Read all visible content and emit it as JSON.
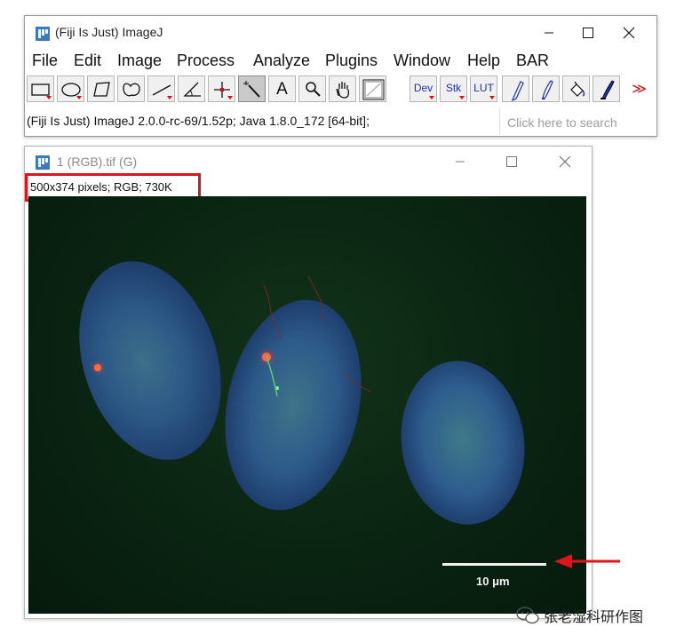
{
  "main_window": {
    "title": "(Fiji Is Just) ImageJ",
    "controls": {
      "minimize": "minimize",
      "maximize": "maximize",
      "close": "close"
    },
    "menu": [
      "File",
      "Edit",
      "Image",
      "Process",
      "Analyze",
      "Plugins",
      "Window",
      "Help",
      "BAR"
    ],
    "tools": [
      {
        "name": "rectangle-tool",
        "icon": "rectangle-icon"
      },
      {
        "name": "oval-tool",
        "icon": "oval-icon"
      },
      {
        "name": "polygon-tool",
        "icon": "polygon-icon"
      },
      {
        "name": "freehand-tool",
        "icon": "freehand-icon"
      },
      {
        "name": "line-tool",
        "icon": "line-icon"
      },
      {
        "name": "angle-tool",
        "icon": "angle-icon"
      },
      {
        "name": "point-tool",
        "icon": "crosshair-icon"
      },
      {
        "name": "wand-tool",
        "icon": "wand-icon"
      },
      {
        "name": "text-tool",
        "icon": "text-icon",
        "label": "A"
      },
      {
        "name": "zoom-tool",
        "icon": "magnifier-icon"
      },
      {
        "name": "hand-tool",
        "icon": "hand-icon"
      },
      {
        "name": "color-picker-tool",
        "icon": "color-picker-icon"
      },
      {
        "name": "dev-tool",
        "label": "Dev"
      },
      {
        "name": "stk-tool",
        "label": "Stk"
      },
      {
        "name": "lut-tool",
        "label": "LUT"
      },
      {
        "name": "pencil-tool",
        "icon": "pencil-icon"
      },
      {
        "name": "brush-tool",
        "icon": "brush-icon"
      },
      {
        "name": "flood-fill-tool",
        "icon": "paint-bucket-icon"
      },
      {
        "name": "paintbrush-tool",
        "icon": "paintbrush-icon"
      },
      {
        "name": "more-tools",
        "icon": "double-chevron-icon",
        "label": "≫"
      }
    ],
    "status": "(Fiji Is Just) ImageJ 2.0.0-rc-69/1.52p; Java 1.8.0_172 [64-bit];",
    "search_placeholder": "Click here to search"
  },
  "image_window": {
    "title": "1 (RGB).tif (G)",
    "info": "500x374 pixels; RGB; 730K",
    "scale_bar_label": "10 μm"
  },
  "colors": {
    "highlight": "#e0131a",
    "tool_accent": "#1b2fbf",
    "tool_dropdown": "#d01010"
  },
  "watermark": {
    "text": "张老湿科研作图",
    "icon": "wechat-icon"
  }
}
